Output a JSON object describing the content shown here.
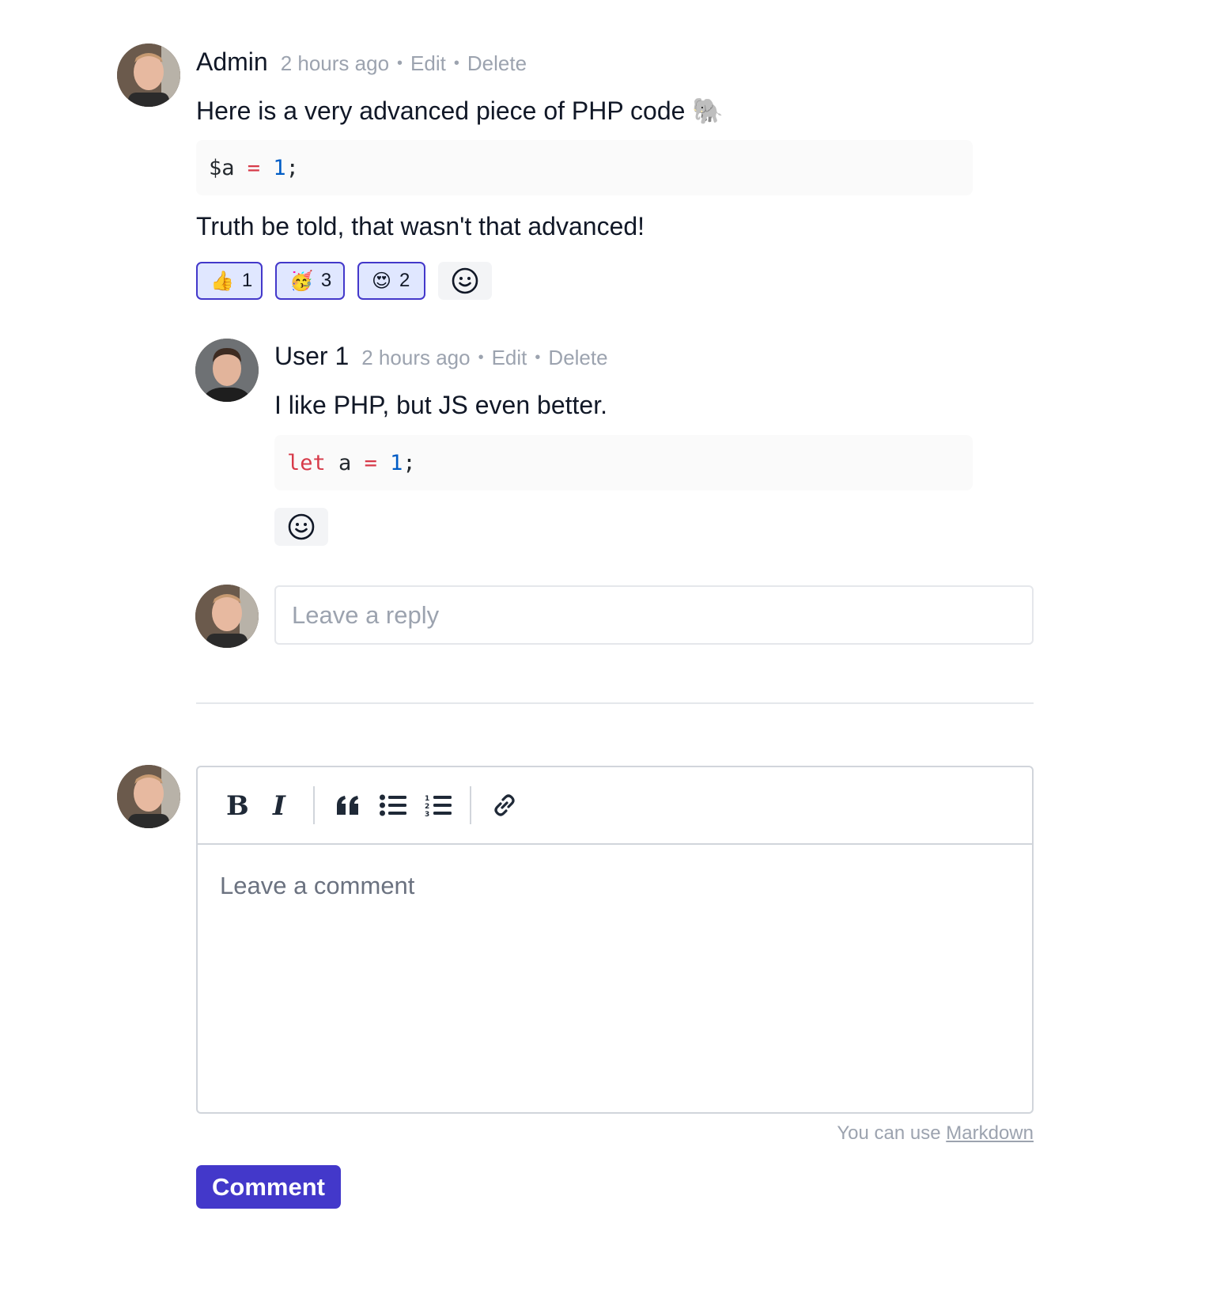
{
  "comment": {
    "author": "Admin",
    "time": "2 hours ago",
    "edit_label": "Edit",
    "delete_label": "Delete",
    "text_intro": "Here is a very advanced piece of PHP code 🐘",
    "code": {
      "var": "$a",
      "op": "=",
      "num": "1",
      "end": ";"
    },
    "text_outro": "Truth be told, that wasn't that advanced!",
    "reactions": [
      {
        "emoji": "👍",
        "count": "1"
      },
      {
        "emoji": "🥳",
        "count": "3"
      },
      {
        "emoji": "😍",
        "count": "2"
      }
    ]
  },
  "reply": {
    "author": "User 1",
    "time": "2 hours ago",
    "edit_label": "Edit",
    "delete_label": "Delete",
    "text": "I like PHP, but JS even better.",
    "code": {
      "kw": "let",
      "var": "a",
      "op": "=",
      "num": "1",
      "end": ";"
    }
  },
  "reply_input": {
    "placeholder": "Leave a reply"
  },
  "editor": {
    "placeholder": "Leave a comment",
    "hint_prefix": "You can use",
    "hint_link": "Markdown",
    "submit_label": "Comment"
  },
  "colors": {
    "accent": "#4338ca",
    "reaction_bg": "#e0e7ff",
    "muted": "#9ca3af"
  }
}
